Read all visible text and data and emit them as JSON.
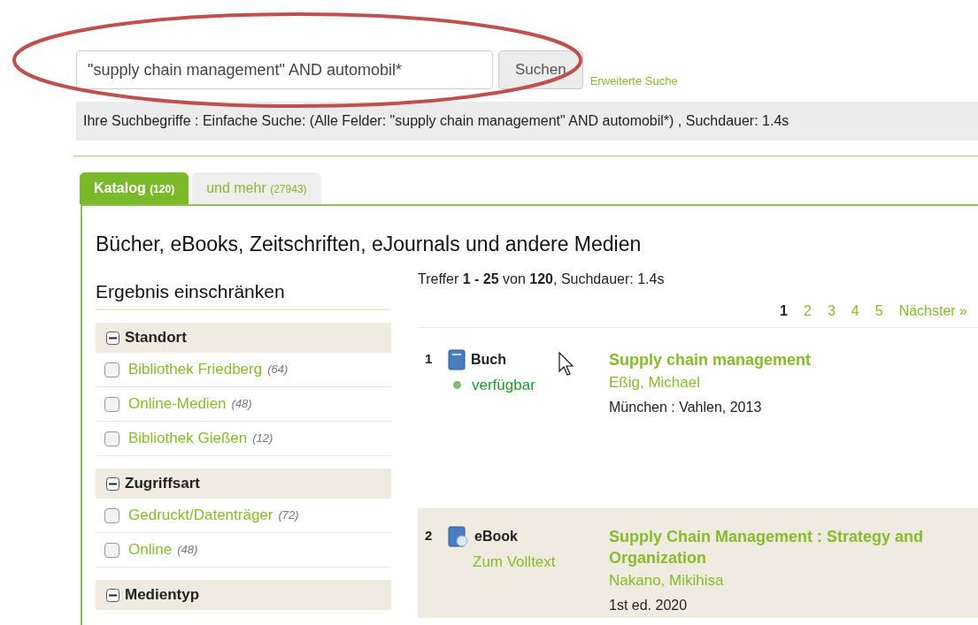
{
  "search": {
    "value": "\"supply chain management\" AND automobil*",
    "button": "Suchen",
    "advanced_link": "Erweiterte Suche"
  },
  "query_info": "Ihre Suchbegriffe : Einfache Suche: (Alle Felder: \"supply chain management\" AND automobil*) , Suchdauer: 1.4s",
  "tabs": [
    {
      "label": "Katalog",
      "count": "(120)",
      "selected": true
    },
    {
      "label": "und mehr",
      "count": "(27943)",
      "selected": false
    }
  ],
  "heading": "Bücher, eBooks, Zeitschriften, eJournals und andere Medien",
  "facets": {
    "title": "Ergebnis einschränken",
    "groups": [
      {
        "name": "Standort",
        "expanded": true,
        "items": [
          {
            "label": "Bibliothek Friedberg",
            "count": "(64)",
            "checked": false
          },
          {
            "label": "Online-Medien",
            "count": "(48)",
            "checked": false
          },
          {
            "label": "Bibliothek Gießen",
            "count": "(12)",
            "checked": false
          }
        ]
      },
      {
        "name": "Zugriffsart",
        "expanded": true,
        "items": [
          {
            "label": "Gedruckt/Datenträger",
            "count": "(72)",
            "checked": false
          },
          {
            "label": "Online",
            "count": "(48)",
            "checked": false
          }
        ]
      },
      {
        "name": "Medientyp",
        "expanded": true
      }
    ]
  },
  "summary": "Treffer **1 - 25** von **120**, Suchdauer: 1.4s",
  "pagination": [
    {
      "label": "1",
      "selected": true
    },
    {
      "label": "2",
      "selected": false
    },
    {
      "label": "3",
      "selected": false
    },
    {
      "label": "4",
      "selected": false
    },
    {
      "label": "5",
      "selected": false
    },
    {
      "label": "Nächster »",
      "selected": false
    }
  ],
  "results": [
    {
      "number": "1",
      "kind": "book",
      "type": "Buch",
      "status": {
        "kind": "available",
        "label": "verfügbar"
      },
      "title": "Supply chain management",
      "author": "Eßig, Michael",
      "publication": "München : Vahlen, 2013"
    },
    {
      "number": "2",
      "kind": "ebook",
      "type": "eBook",
      "status": {
        "kind": "link",
        "label": "Zum Volltext"
      },
      "title": "Supply Chain Management : Strategy and Organization",
      "author": "Nakano, Mikihisa",
      "publication": "1st ed. 2020"
    }
  ]
}
